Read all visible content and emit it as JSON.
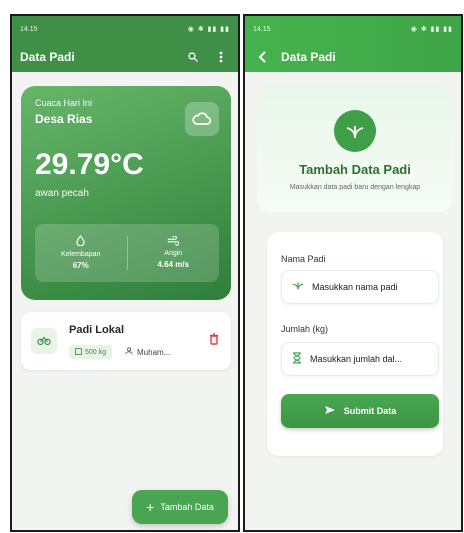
{
  "left_phone": {
    "status_time": "14.15",
    "app_title": "Data Padi",
    "weather": {
      "today_label": "Cuaca Hari Ini",
      "location": "Desa Rias",
      "temperature": "29.79°C",
      "description": "awan pecah",
      "humidity_label": "Kelembapan",
      "humidity_value": "67%",
      "wind_label": "Angin",
      "wind_value": "4.64 m/s"
    },
    "item": {
      "name": "Padi Lokal",
      "quantity": "500 kg",
      "owner": "Muham..."
    },
    "fab_label": "Tambah Data"
  },
  "right_phone": {
    "status_time": "14.15",
    "app_title": "Data Padi",
    "hero_title": "Tambah Data Padi",
    "hero_subtitle": "Masukkan data padi baru dengan lengkap",
    "name_label": "Nama Padi",
    "name_placeholder": "Masukkan nama padi",
    "qty_label": "Jumlah (kg)",
    "qty_placeholder": "Masukkan jumlah dal...",
    "submit_label": "Submit Data"
  },
  "colors": {
    "primary": "#3f8f47",
    "accent": "#4aa552",
    "danger": "#e33b3b"
  }
}
